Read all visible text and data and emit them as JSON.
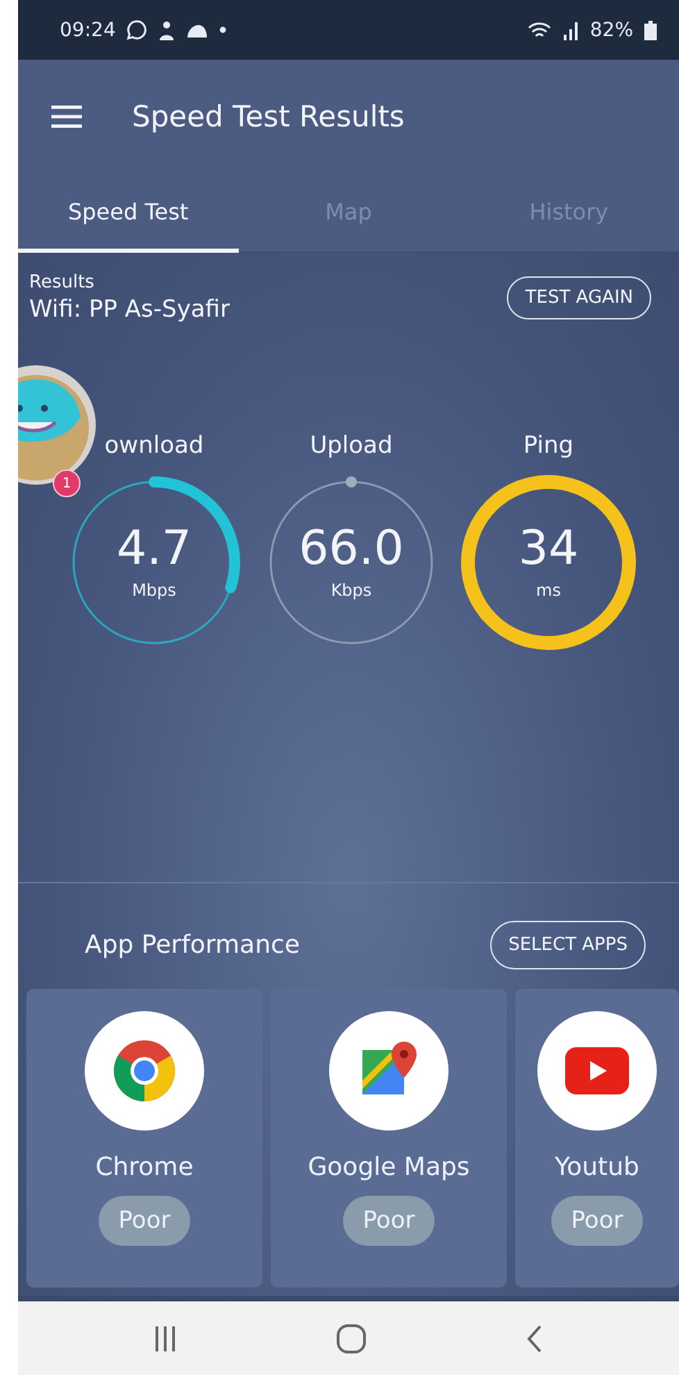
{
  "status_bar": {
    "time": "09:24",
    "battery": "82%"
  },
  "app_bar": {
    "title": "Speed Test Results"
  },
  "tabs": [
    {
      "label": "Speed Test",
      "selected": true
    },
    {
      "label": "Map",
      "selected": false
    },
    {
      "label": "History",
      "selected": false
    }
  ],
  "results": {
    "heading": "Results",
    "network": "Wifi: PP As-Syafir",
    "button": "TEST AGAIN"
  },
  "chat_head": {
    "badge": "1"
  },
  "gauges": [
    {
      "label": "ownload",
      "value": "4.7",
      "unit": "Mbps",
      "level": 0.3,
      "color": "#22c3d6"
    },
    {
      "label": "Upload",
      "value": "66.0",
      "unit": "Kbps",
      "level": 0,
      "color": "#a3acb9"
    },
    {
      "label": "Ping",
      "value": "34",
      "unit": "ms",
      "level": 1,
      "color": "#f5c21b"
    }
  ],
  "app_performance": {
    "title": "App Performance",
    "button": "SELECT APPS",
    "apps": [
      {
        "kind": "chrome",
        "name": "Chrome",
        "rating": "Poor"
      },
      {
        "kind": "maps",
        "name": "Google Maps",
        "rating": "Poor"
      },
      {
        "kind": "youtube",
        "name": "Youtub",
        "rating": "Poor"
      }
    ]
  }
}
